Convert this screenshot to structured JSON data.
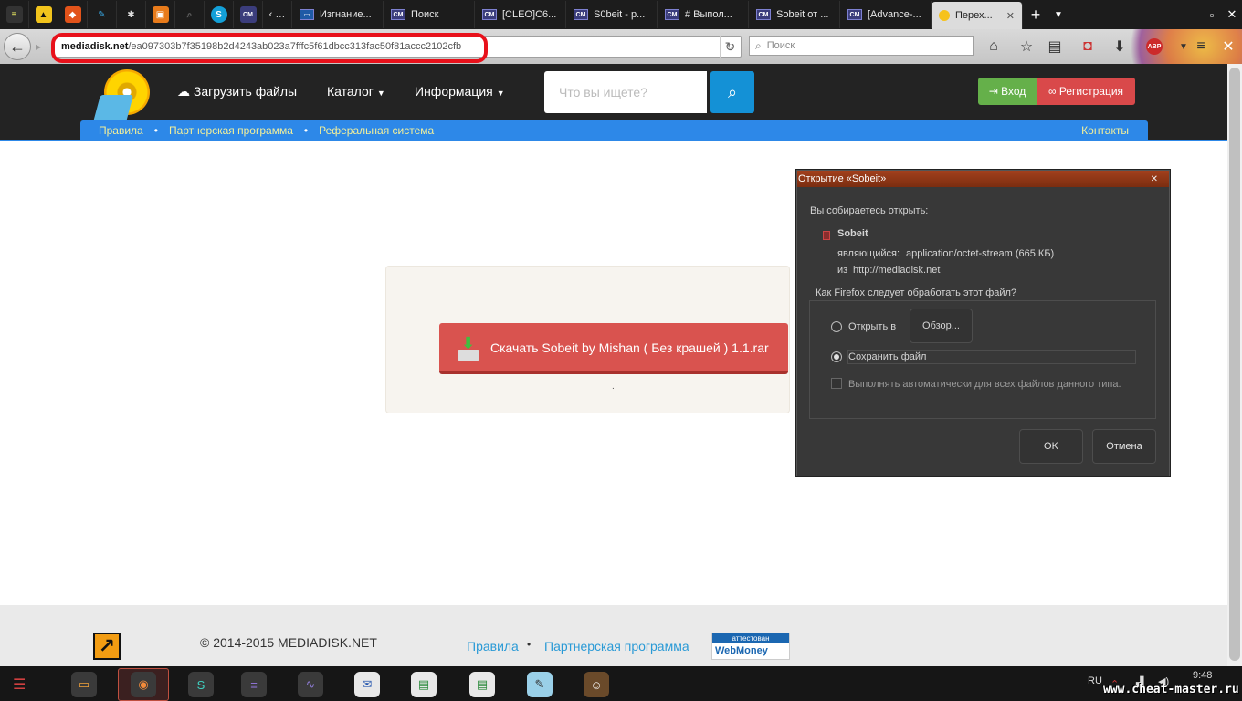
{
  "browser": {
    "tabs": [
      {
        "label": "Изгнание..."
      },
      {
        "label": "Поиск"
      },
      {
        "label": "[CLEO]C6..."
      },
      {
        "label": "S0beit - p..."
      },
      {
        "label": "# Выпол..."
      },
      {
        "label": "Sobeit от ..."
      },
      {
        "label": "[Advance-..."
      },
      {
        "label": "Перех..."
      }
    ],
    "tab_icon_text": "CM",
    "url_domain": "mediadisk.net",
    "url_path": "/ea097303b7f35198b2d4243ab023a7fffc5f61dbcc313fac50f81accc2102cfb",
    "search_placeholder": "Поиск",
    "abp_label": "ABP",
    "new_tab": "+",
    "highlight_color": "#e8111b"
  },
  "site": {
    "nav": {
      "upload": "Загрузить файлы",
      "catalog": "Каталог",
      "info": "Информация"
    },
    "search_placeholder": "Что вы ищете?",
    "login": "Вход",
    "register": "Регистрация",
    "subnav": {
      "rules": "Правила",
      "partner": "Партнерская программа",
      "referral": "Реферальная система",
      "contacts": "Контакты"
    },
    "download_button": "Скачать Sobeit by Mishan ( Без крашей ) 1.1.rar",
    "dot_mark": ".",
    "footer": {
      "copyright": "© 2014-2015 MEDIADISK.NET",
      "rules": "Правила",
      "bullet": "•",
      "partner": "Партнерская программа",
      "webmoney_top": "аттестован",
      "webmoney_bottom": "WebMoney"
    },
    "colors": {
      "accent": "#2d88e8",
      "download": "#d9534f",
      "login": "#65b04a",
      "register": "#d9494a"
    }
  },
  "dialog": {
    "title": "Открытие «Sobeit»",
    "intro": "Вы собираетесь открыть:",
    "filename": "Sobeit",
    "type_label": "являющийся:",
    "type_value": "application/octet-stream (665 КБ)",
    "from_label": "из",
    "from_value": "http://mediadisk.net",
    "question": "Как Firefox следует обработать этот файл?",
    "open_with": "Открыть в",
    "browse": "Обзор...",
    "save_file": "Сохранить файл",
    "auto": "Выполнять автоматически для всех файлов данного типа.",
    "ok": "OK",
    "cancel": "Отмена",
    "selected_option": "save_file"
  },
  "taskbar": {
    "lang": "RU",
    "time": "9:48",
    "watermark": "www.cheat-master.ru"
  }
}
